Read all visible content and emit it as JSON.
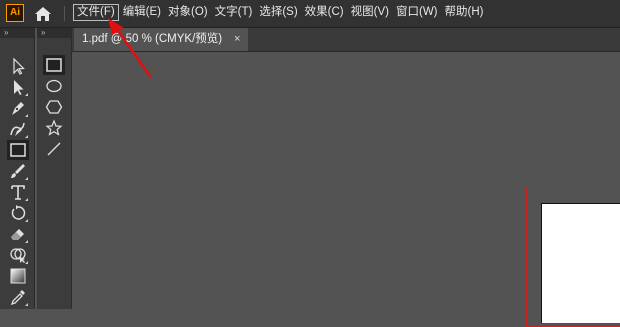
{
  "app": {
    "logo_text": "Ai"
  },
  "menu": {
    "items": [
      {
        "label": "文件(F)",
        "active": true
      },
      {
        "label": "编辑(E)"
      },
      {
        "label": "对象(O)"
      },
      {
        "label": "文字(T)"
      },
      {
        "label": "选择(S)"
      },
      {
        "label": "效果(C)"
      },
      {
        "label": "视图(V)"
      },
      {
        "label": "窗口(W)"
      },
      {
        "label": "帮助(H)"
      }
    ]
  },
  "panels": {
    "collapse_glyph": "»",
    "tools": [
      "selection-tool",
      "direct-selection-tool",
      "pen-tool",
      "curvature-tool",
      "rectangle-tool",
      "paintbrush-tool",
      "type-tool",
      "rotate-tool",
      "eraser-tool",
      "shape-builder-tool",
      "gradient-tool",
      "eyedropper-tool"
    ],
    "shape_tools": [
      "rectangle-tool",
      "ellipse-tool",
      "polygon-tool",
      "star-tool",
      "line-segment-tool"
    ]
  },
  "document": {
    "tab_title": "1.pdf @ 50 % (CMYK/预览)",
    "close_glyph": "×"
  },
  "colors": {
    "menubar_bg": "#323232",
    "panel_bg": "#3c3c3c",
    "canvas_bg": "#535353",
    "bleed_line": "#d01f1f",
    "annotation_arrow": "#e01010",
    "logo_accent": "#ff9a00"
  }
}
